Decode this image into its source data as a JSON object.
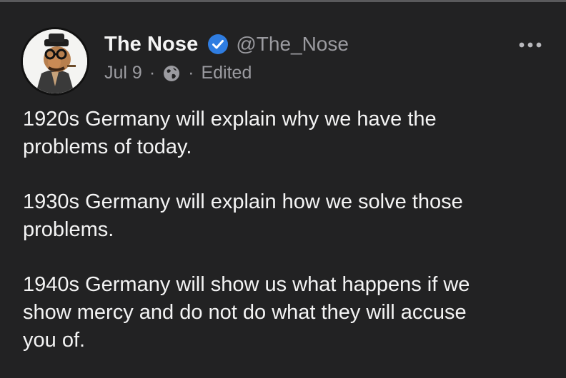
{
  "post": {
    "author": {
      "display_name": "The Nose",
      "handle": "@The_Nose",
      "verified": true,
      "avatar_icon": "cartoon-nose-with-hat-and-glasses"
    },
    "meta": {
      "date": "Jul 9",
      "separator": "·",
      "visibility_icon": "globe-icon",
      "edited_label": "Edited"
    },
    "paragraphs": [
      "1920s Germany will explain why we have the\nproblems of today.",
      "1930s Germany will explain how we solve those\nproblems.",
      "1940s Germany will show us what happens if we\nshow mercy and do not do what they will accuse\nyou of."
    ]
  },
  "colors": {
    "background": "#222223",
    "primary_text": "#f4f4f4",
    "secondary_text": "#9b9ba0",
    "verified_badge": "#2f7de1"
  }
}
